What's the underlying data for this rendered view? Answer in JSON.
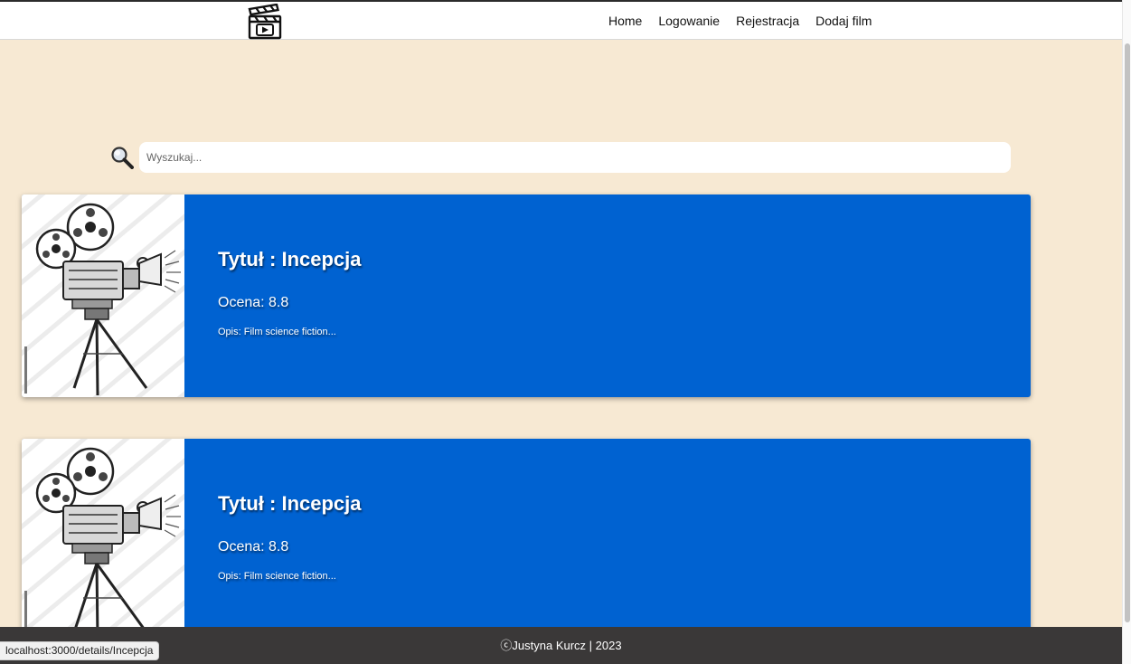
{
  "nav": {
    "logo_icon": "clapperboard-icon",
    "links": [
      "Home",
      "Logowanie",
      "Rejestracja",
      "Dodaj film"
    ]
  },
  "search": {
    "icon": "search-icon",
    "placeholder": "Wyszukaj...",
    "value": ""
  },
  "films": [
    {
      "image_icon": "film-camera-illustration",
      "title": "Tytuł : Incepcja",
      "rating": "Ocena: 8.8",
      "description": "Opis: Film science fiction..."
    },
    {
      "image_icon": "film-camera-illustration",
      "title": "Tytuł : Incepcja",
      "rating": "Ocena: 8.8",
      "description": "Opis: Film science fiction..."
    }
  ],
  "footer": {
    "text": "ⓒJustyna Kurcz | 2023"
  },
  "status_bar": {
    "url": "localhost:3000/details/Incepcja"
  },
  "colors": {
    "background": "#f7e9d3",
    "card": "#0062d1",
    "footer": "#3a3838",
    "navbar": "#ffffff"
  }
}
